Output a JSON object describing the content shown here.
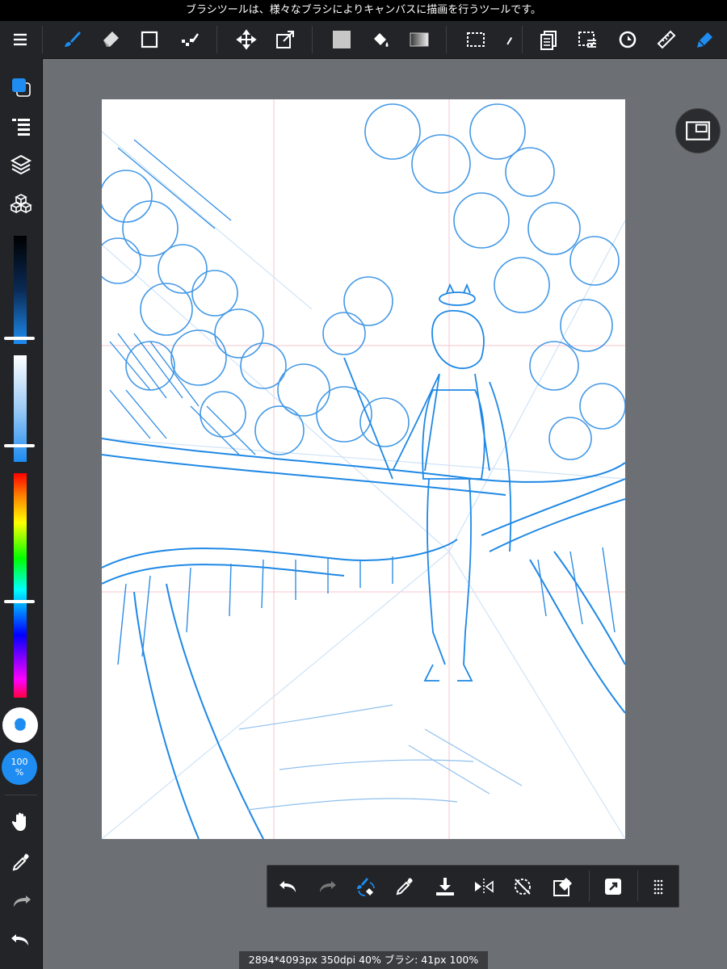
{
  "tooltip": "ブラシツールは、様々なブラシによりキャンバスに描画を行うツールです。",
  "top_toolbar": {
    "tools": [
      {
        "name": "menu-icon"
      },
      {
        "name": "brush-tool-icon",
        "active": true
      },
      {
        "name": "eraser-tool-icon"
      },
      {
        "name": "object-tool-icon"
      },
      {
        "name": "filter-tool-icon"
      },
      {
        "name": "move-tool-icon"
      },
      {
        "name": "transform-tool-icon"
      },
      {
        "name": "fill-color-icon"
      },
      {
        "name": "bucket-tool-icon"
      },
      {
        "name": "gradient-tool-icon"
      },
      {
        "name": "select-tool-icon"
      },
      {
        "name": "lasso-tool-icon"
      },
      {
        "name": "copy-tool-icon"
      },
      {
        "name": "selection-menu-icon"
      },
      {
        "name": "snap-icon"
      },
      {
        "name": "ruler-icon"
      },
      {
        "name": "text-tool-icon"
      }
    ]
  },
  "sidebar": {
    "brush_opacity_label": "100\n%",
    "sliders": {
      "brightness_level": 0.82,
      "saturation_level": 0.85,
      "hue_level": 0.57
    }
  },
  "quick_bar": {
    "items": [
      "undo",
      "redo",
      "brush-switch",
      "eyedropper",
      "save",
      "flip-horizontal",
      "rotation-reset",
      "clear-layer",
      "share",
      "more"
    ]
  },
  "status_bar": "2894*4093px 350dpi 40% ブラシ: 41px 100%",
  "colors": {
    "accent": "#1e8cf0",
    "toolbar_bg": "#222427",
    "workspace_bg": "#6c6f73",
    "sketch_stroke": "#1e88e5"
  }
}
